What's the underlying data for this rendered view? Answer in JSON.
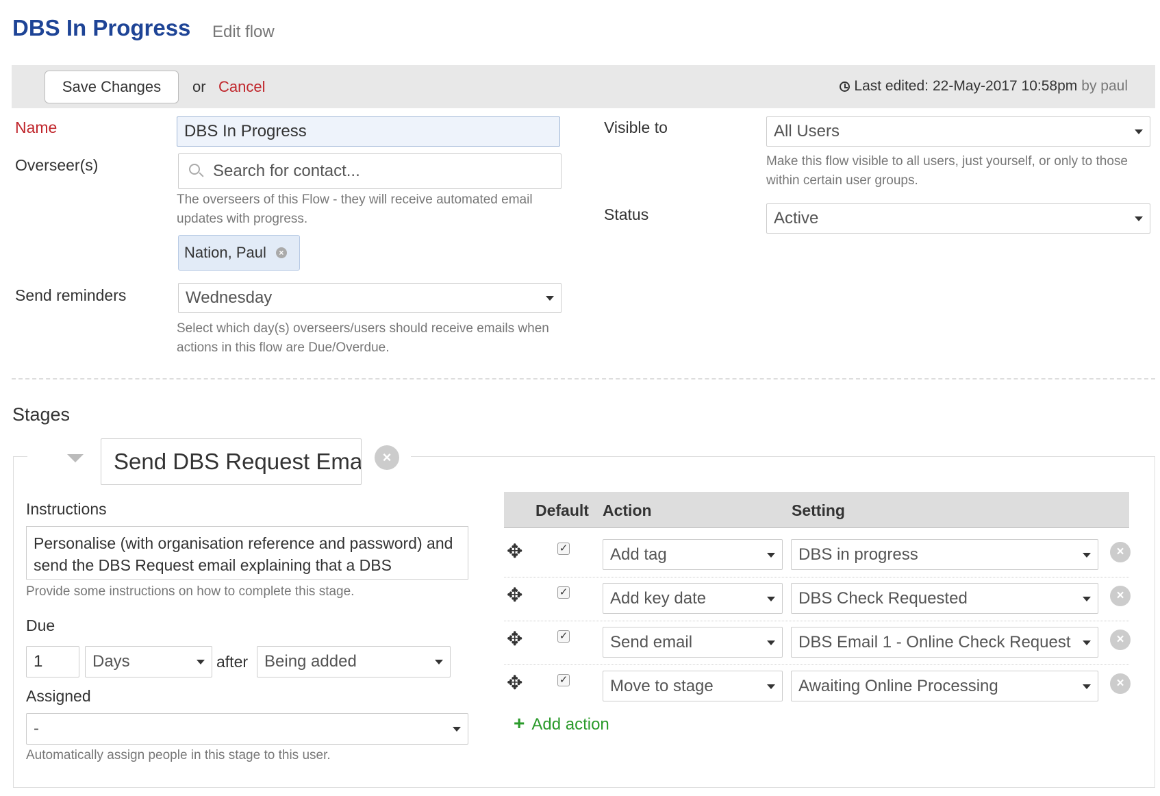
{
  "header": {
    "title": "DBS In Progress",
    "subtitle": "Edit flow"
  },
  "toolbar": {
    "save_label": "Save Changes",
    "or_text": "or",
    "cancel_label": "Cancel",
    "last_edited_label": "Last edited:",
    "last_edited_value": "22-May-2017 10:58pm",
    "by_text": "by paul"
  },
  "form": {
    "name_label": "Name",
    "name_value": "DBS In Progress",
    "overseers_label": "Overseer(s)",
    "overseers_placeholder": "Search for contact...",
    "overseers_help": "The overseers of this Flow - they will receive automated email updates with progress.",
    "overseer_tag": "Nation, Paul",
    "reminders_label": "Send reminders",
    "reminders_value": "Wednesday",
    "reminders_help": "Select which day(s) overseers/users should receive emails when actions in this flow are Due/Overdue.",
    "visible_label": "Visible to",
    "visible_value": "All Users",
    "visible_help": "Make this flow visible to all users, just yourself, or only to those within certain user groups.",
    "status_label": "Status",
    "status_value": "Active"
  },
  "stages": {
    "title": "Stages",
    "stage_name": "Send DBS Request Email",
    "instructions_label": "Instructions",
    "instructions_text": "Personalise (with organisation reference and password) and send the DBS Request email explaining that a DBS",
    "instructions_help": "Provide some instructions on how to complete this stage.",
    "due_label": "Due",
    "due_amount": "1",
    "due_unit": "Days",
    "after_text": "after",
    "due_event": "Being added",
    "assigned_label": "Assigned",
    "assigned_value": "-",
    "assigned_help": "Automatically assign people in this stage to this user."
  },
  "actions": {
    "headers": {
      "default": "Default",
      "action": "Action",
      "setting": "Setting"
    },
    "rows": [
      {
        "action": "Add tag",
        "setting": "DBS in progress"
      },
      {
        "action": "Add key date",
        "setting": "DBS Check Requested"
      },
      {
        "action": "Send email",
        "setting": "DBS Email 1 - Online Check Request"
      },
      {
        "action": "Move to stage",
        "setting": "Awaiting Online Processing"
      }
    ],
    "add_label": "Add action"
  },
  "colors": {
    "title_blue": "#1e4496",
    "required_red": "#c0262c",
    "add_green": "#2a9a2a"
  }
}
